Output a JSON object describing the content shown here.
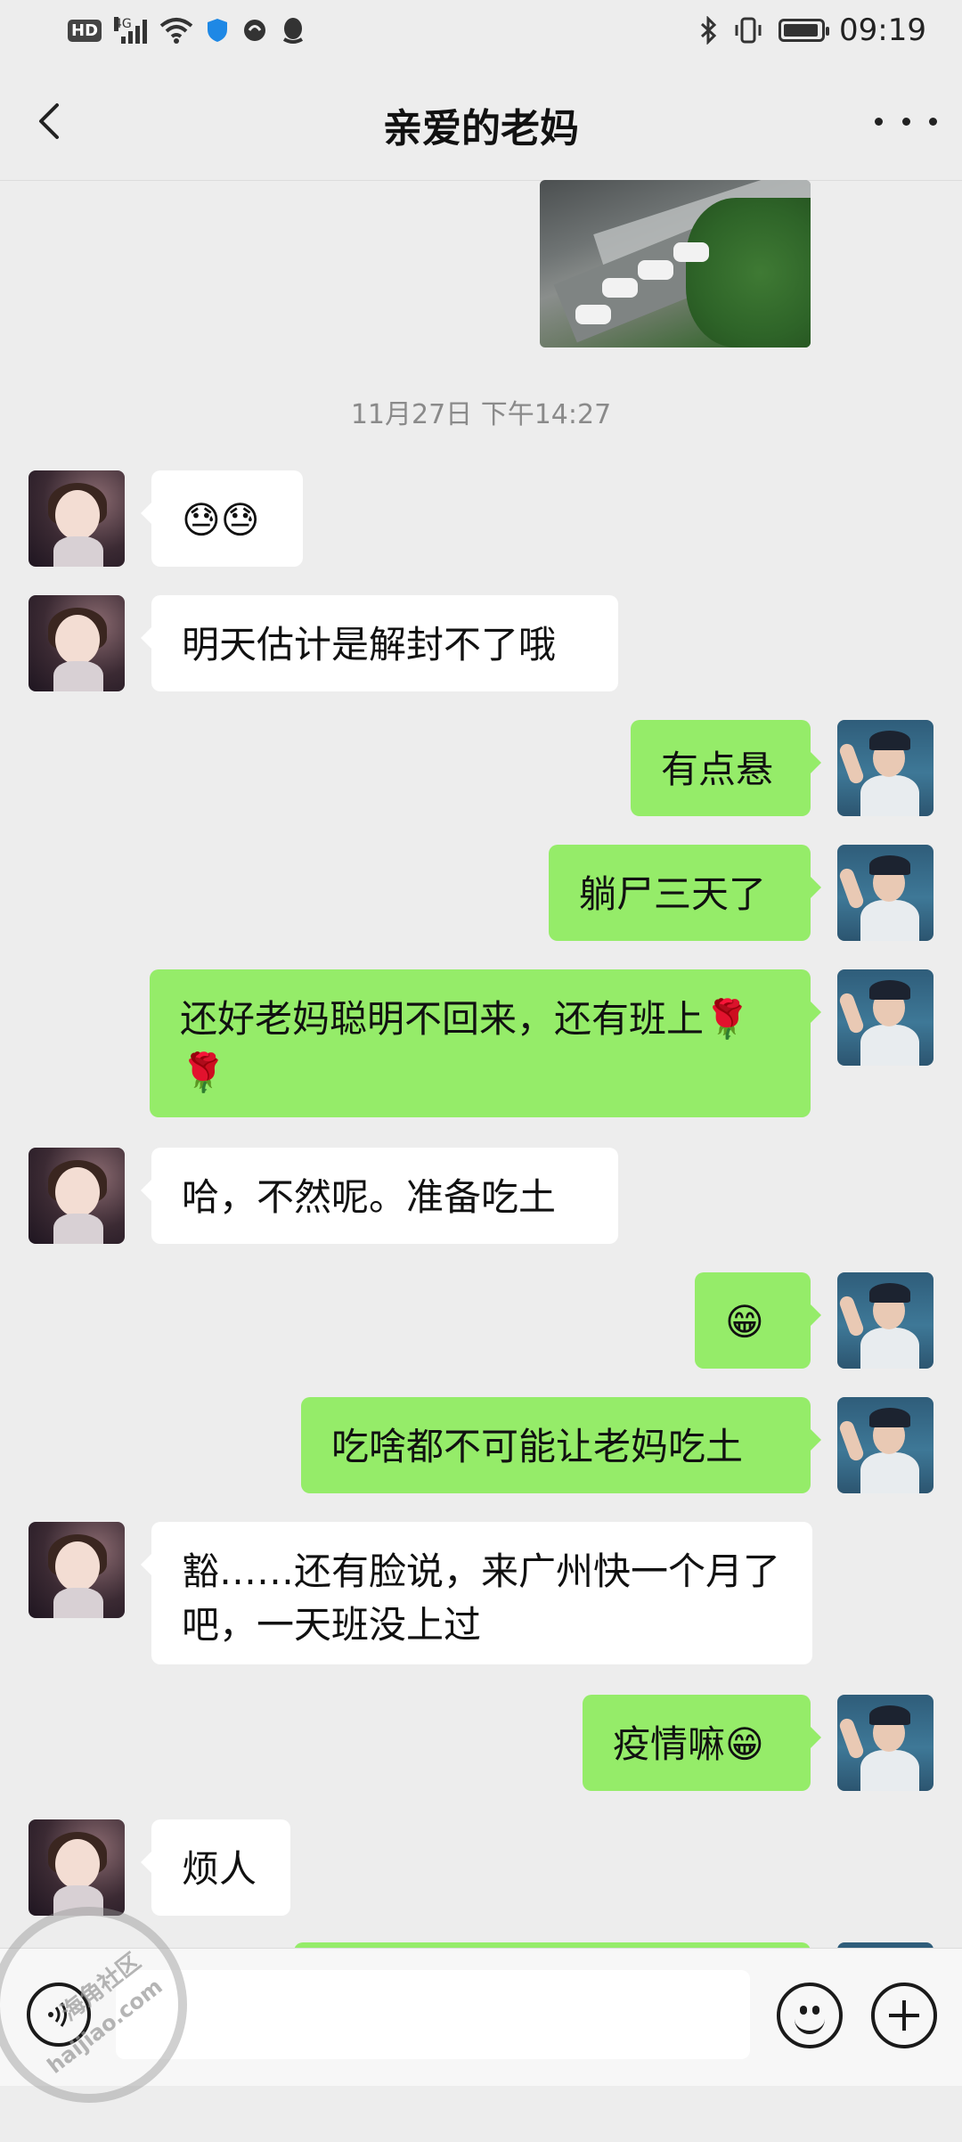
{
  "status_bar": {
    "hd_label": "HD",
    "network_label": "4G",
    "time": "09:19"
  },
  "header": {
    "title": "亲爱的老妈"
  },
  "chat": {
    "timestamp": "11月27日 下午14:27",
    "messages": [
      {
        "sender": "mom",
        "side": "left",
        "text": "😓😓"
      },
      {
        "sender": "mom",
        "side": "left",
        "text": "明天估计是解封不了哦"
      },
      {
        "sender": "me",
        "side": "right",
        "text": "有点悬"
      },
      {
        "sender": "me",
        "side": "right",
        "text": "躺尸三天了"
      },
      {
        "sender": "me",
        "side": "right",
        "text": "还好老妈聪明不回来，还有班上🌹🌹"
      },
      {
        "sender": "mom",
        "side": "left",
        "text": "哈，不然呢。准备吃土"
      },
      {
        "sender": "me",
        "side": "right",
        "text": "😁"
      },
      {
        "sender": "me",
        "side": "right",
        "text": "吃啥都不可能让老妈吃土"
      },
      {
        "sender": "mom",
        "side": "left",
        "text": "豁……还有脸说，来广州快一个月了吧，一天班没上过"
      },
      {
        "sender": "me",
        "side": "right",
        "text": "疫情嘛😁"
      },
      {
        "sender": "mom",
        "side": "left",
        "text": "烦人"
      }
    ]
  },
  "input_bar": {
    "text_value": "",
    "voice_icon": "voice-icon",
    "emoji_icon": "emoji-icon",
    "plus_icon": "plus-icon"
  },
  "watermark": {
    "line1": "海角社区",
    "line2": "haijiao.com"
  },
  "colors": {
    "background": "#ededed",
    "my_bubble": "#95ec69",
    "their_bubble": "#ffffff"
  }
}
